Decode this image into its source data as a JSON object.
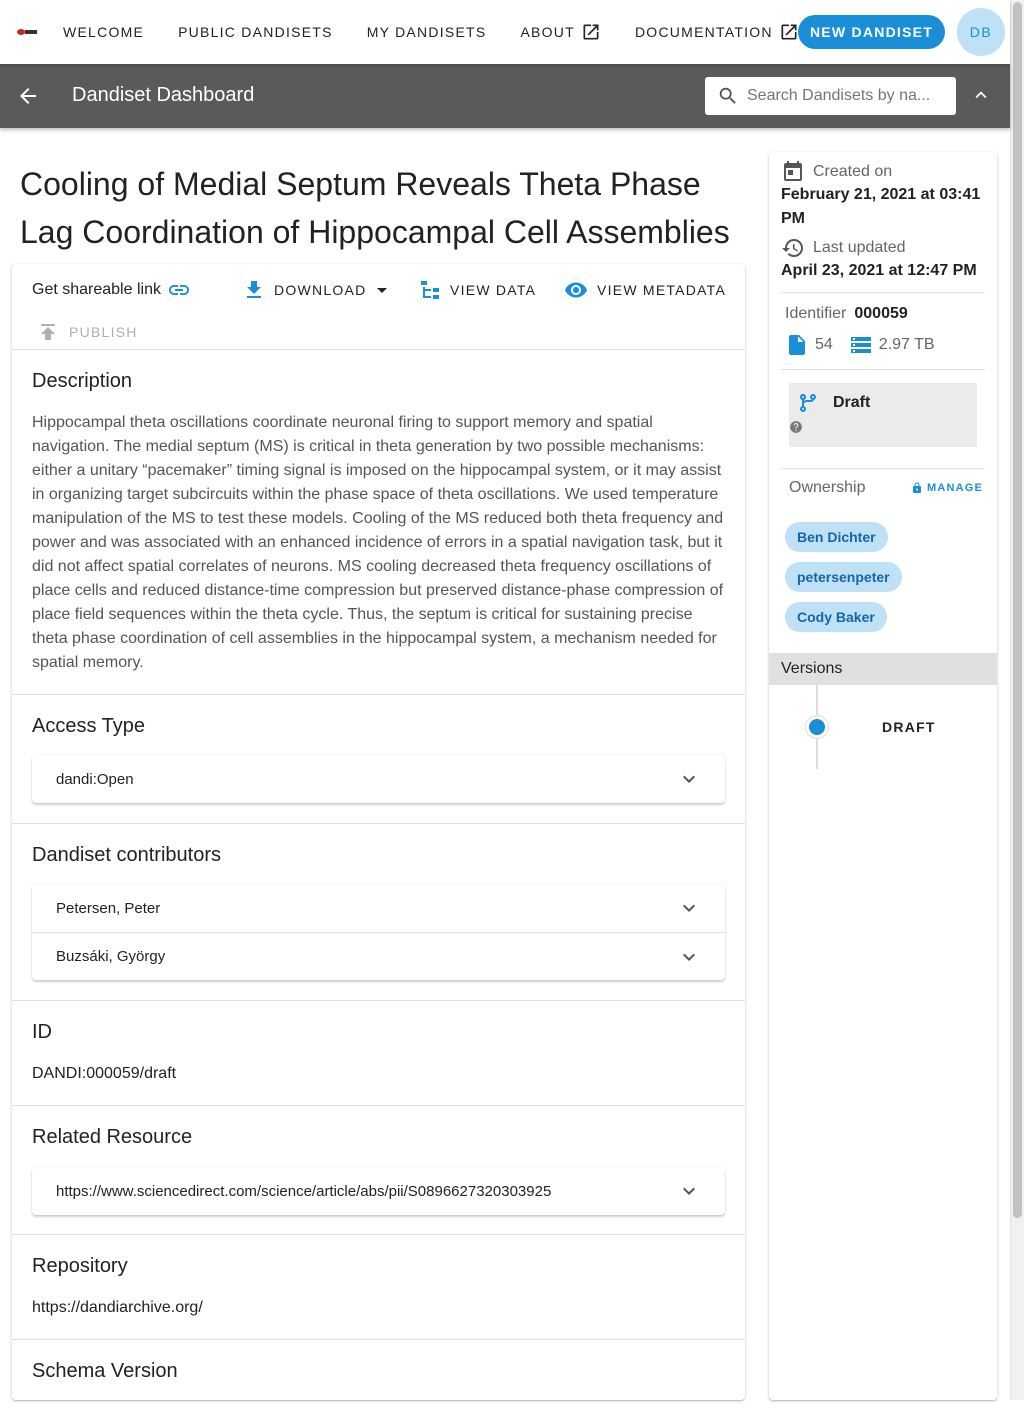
{
  "colors": {
    "accent": "#1a8fd8",
    "toolbar": "#5a5a5a",
    "chip_bg": "#bfe1f6"
  },
  "nav": {
    "items": [
      {
        "label": "WELCOME",
        "external": false
      },
      {
        "label": "PUBLIC DANDISETS",
        "external": false
      },
      {
        "label": "MY DANDISETS",
        "external": false
      },
      {
        "label": "ABOUT",
        "external": true
      },
      {
        "label": "DOCUMENTATION",
        "external": true
      }
    ],
    "new_button": "NEW DANDISET",
    "avatar_initials": "DB"
  },
  "toolbar": {
    "title": "Dandiset Dashboard",
    "search_placeholder": "Search Dandisets by na..."
  },
  "dandiset": {
    "title": "Cooling of Medial Septum Reveals Theta Phase Lag Coordination of Hippocampal Cell Assemblies",
    "actions": {
      "share": "Get shareable link",
      "download": "DOWNLOAD",
      "view_data": "VIEW DATA",
      "view_metadata": "VIEW METADATA",
      "publish": "PUBLISH"
    },
    "description": {
      "heading": "Description",
      "text": "Hippocampal theta oscillations coordinate neuronal firing to support memory and spatial navigation. The medial septum (MS) is critical in theta generation by two possible mechanisms: either a unitary “pacemaker” timing signal is imposed on the hippocampal system, or it may assist in organizing target subcircuits within the phase space of theta oscillations. We used temperature manipulation of the MS to test these models. Cooling of the MS reduced both theta frequency and power and was associated with an enhanced incidence of errors in a spatial navigation task, but it did not affect spatial correlates of neurons. MS cooling decreased theta frequency oscillations of place cells and reduced distance-time compression but preserved distance-phase compression of place field sequences within the theta cycle. Thus, the septum is critical for sustaining precise theta phase coordination of cell assemblies in the hippocampal system, a mechanism needed for spatial memory."
    },
    "access_type": {
      "heading": "Access Type",
      "value": "dandi:Open"
    },
    "contributors": {
      "heading": "Dandiset contributors",
      "items": [
        "Petersen, Peter",
        "Buzsáki, György"
      ]
    },
    "id": {
      "heading": "ID",
      "value": "DANDI:000059/draft"
    },
    "related_resource": {
      "heading": "Related Resource",
      "value": "https://www.sciencedirect.com/science/article/abs/pii/S0896627320303925"
    },
    "repository": {
      "heading": "Repository",
      "value": "https://dandiarchive.org/"
    },
    "schema_version": {
      "heading": "Schema Version"
    }
  },
  "sidebar": {
    "created_label": "Created on",
    "created_value": "February 21, 2021 at 03:41 PM",
    "updated_label": "Last updated",
    "updated_value": "April 23, 2021 at 12:47 PM",
    "identifier_label": "Identifier",
    "identifier_value": "000059",
    "file_count": "54",
    "size": "2.97 TB",
    "status": "Draft",
    "ownership_label": "Ownership",
    "manage_label": "MANAGE",
    "owners": [
      "Ben Dichter",
      "petersenpeter",
      "Cody Baker"
    ],
    "versions_label": "Versions",
    "versions": [
      "DRAFT"
    ]
  }
}
